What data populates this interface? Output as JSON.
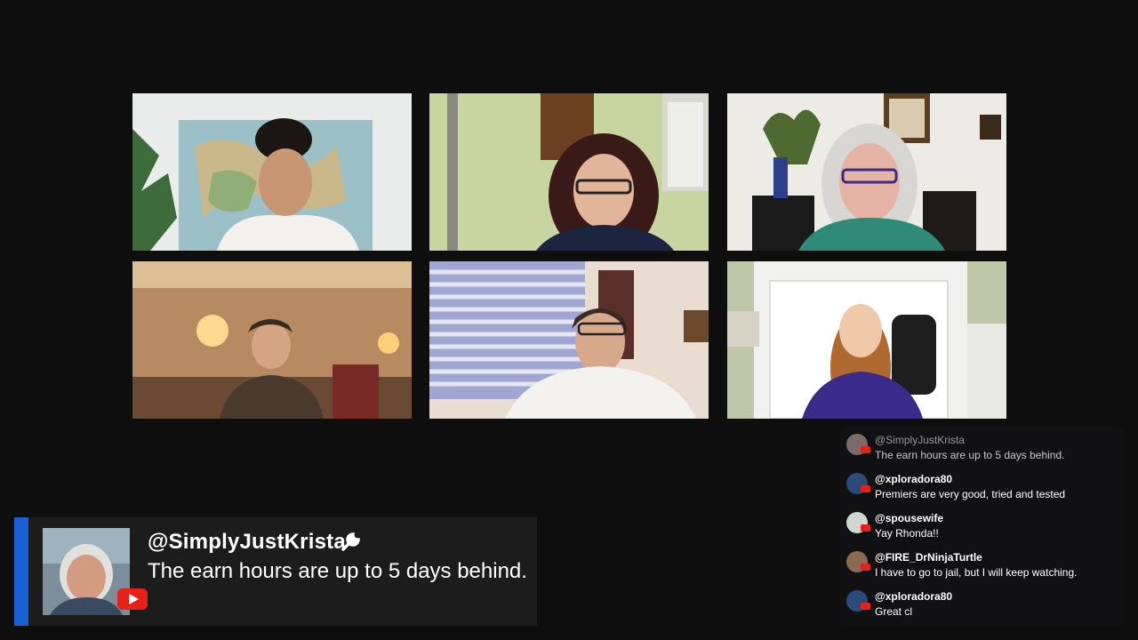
{
  "participants": [
    {
      "label": "participant-top-left"
    },
    {
      "label": "participant-top-center"
    },
    {
      "label": "participant-top-right"
    },
    {
      "label": "participant-bottom-left"
    },
    {
      "label": "participant-bottom-center"
    },
    {
      "label": "participant-bottom-right"
    }
  ],
  "featured_comment": {
    "author": "@SimplyJustKrista",
    "author_icon": "wrench-icon",
    "message": "The earn hours are up to 5 days behind.",
    "badge_icon": "youtube-icon"
  },
  "chat": {
    "messages": [
      {
        "author": "@SimplyJustKrista",
        "text": "The earn hours are up to 5 days behind."
      },
      {
        "author": "@xploradora80",
        "text": "Premiers are very good, tried and tested"
      },
      {
        "author": "@spousewife",
        "text": "Yay Rhonda!!"
      },
      {
        "author": "@FIRE_DrNinjaTurtle",
        "text": "I have to go to jail, but I will keep watching."
      },
      {
        "author": "@xploradora80",
        "text": "Great cl"
      }
    ]
  },
  "colors": {
    "background": "#0e0e0e",
    "accent": "#1a5fd6",
    "youtube_red": "#e62117"
  }
}
